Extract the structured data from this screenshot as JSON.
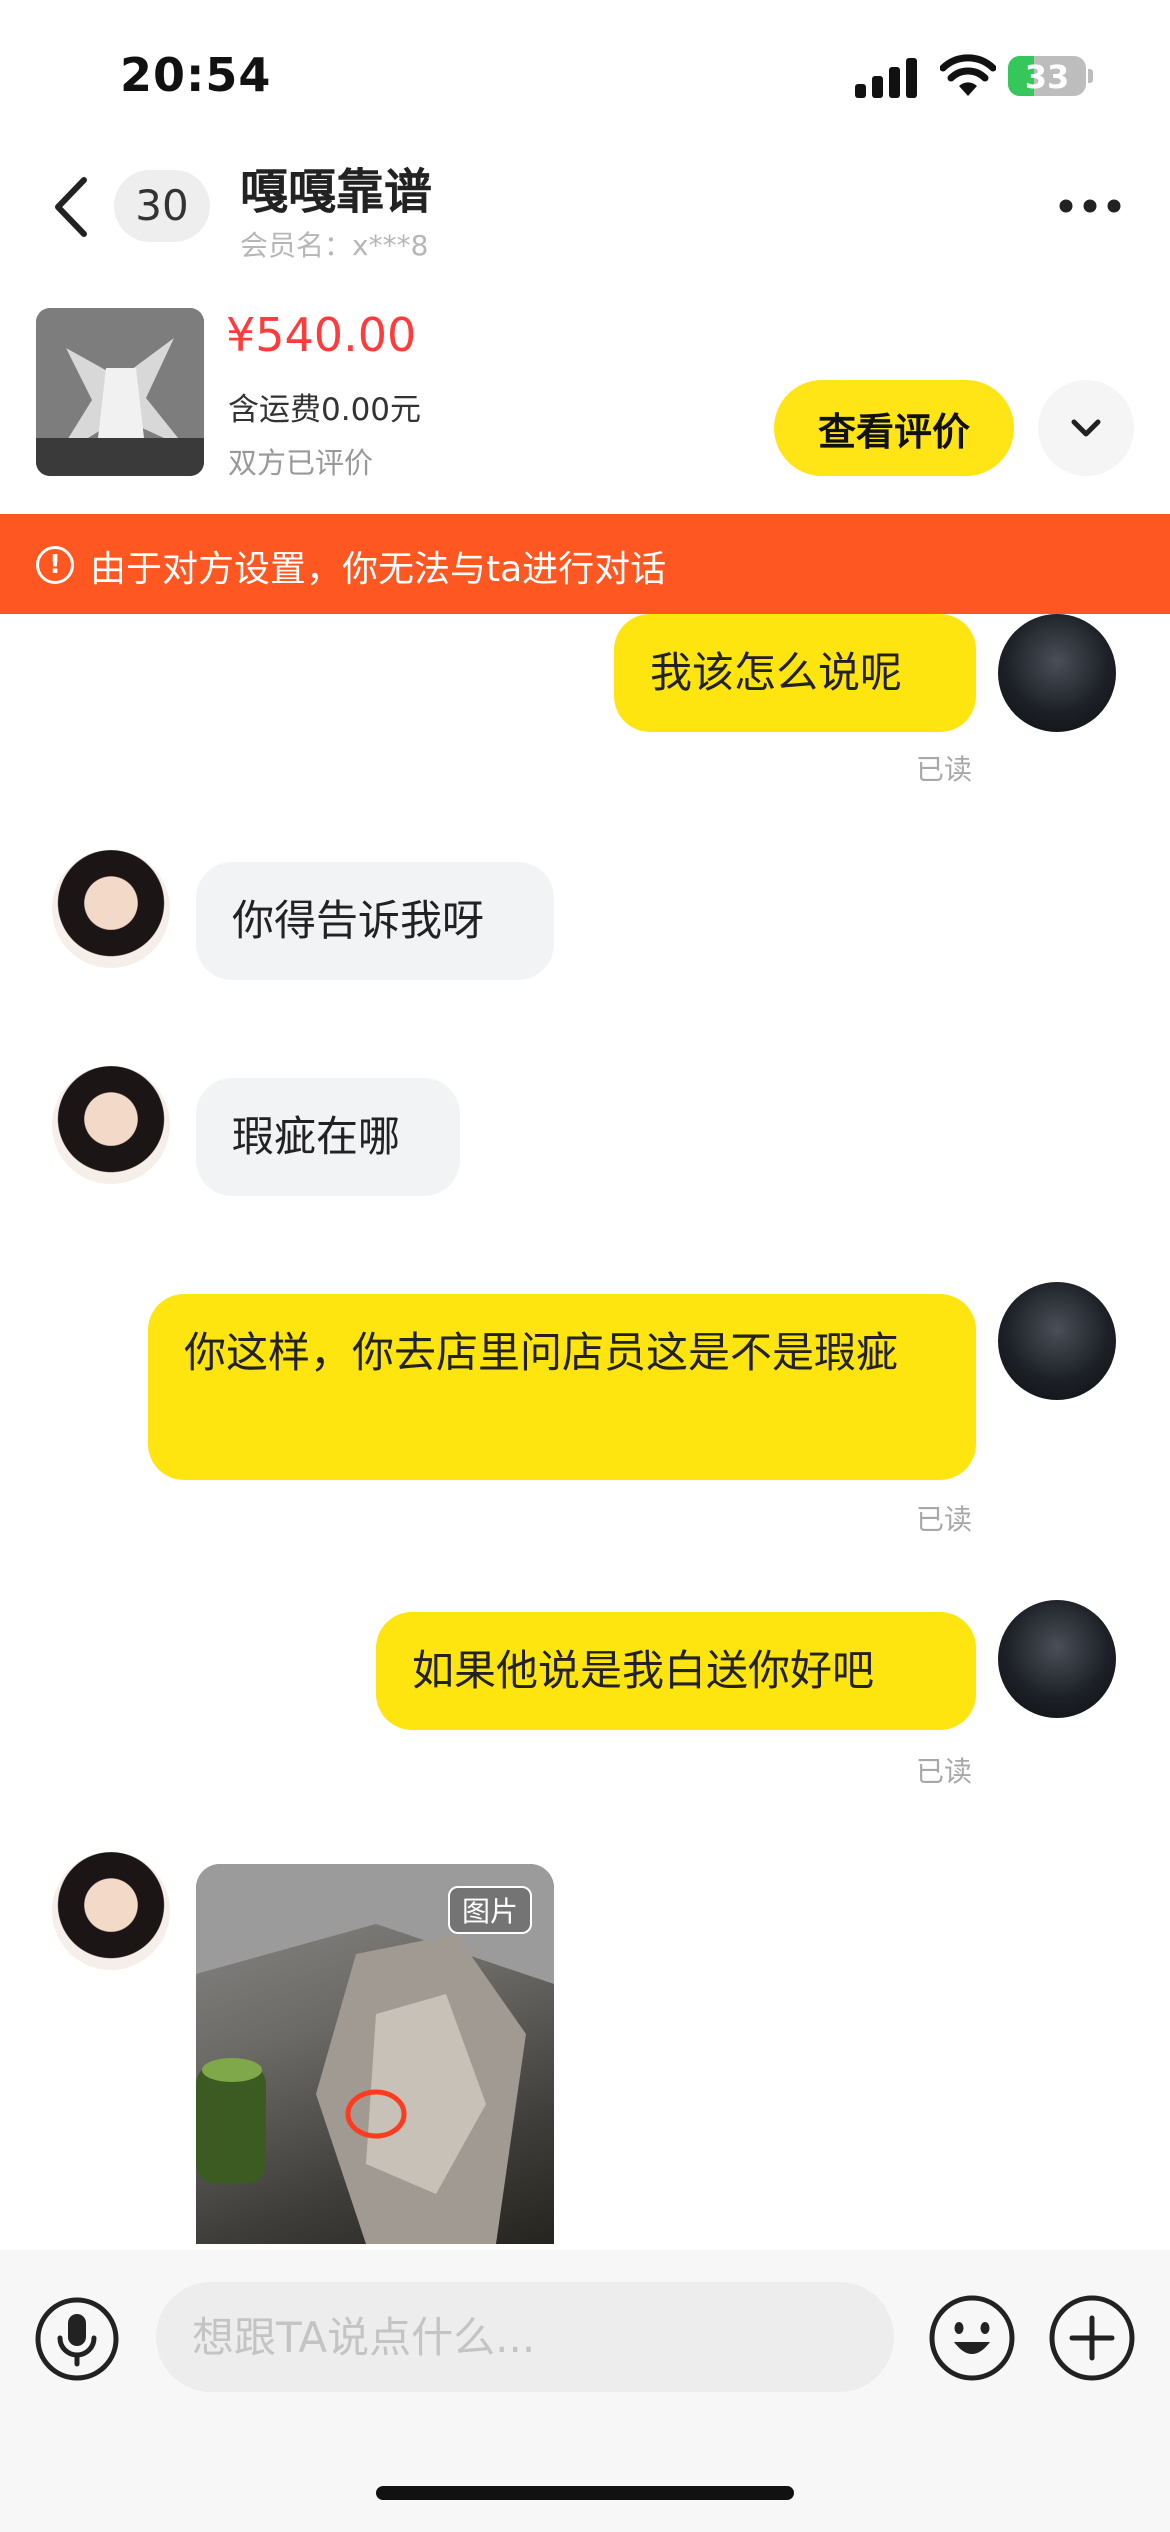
{
  "status_bar": {
    "time": "20:54",
    "battery": "33",
    "battery_level": 0.33
  },
  "header": {
    "unread_count": "30",
    "title": "嘎嘎靠谱",
    "subtitle": "会员名：x***8"
  },
  "product": {
    "price": "¥540.00",
    "shipping": "含运费0.00元",
    "rating_status": "双方已评价",
    "review_button": "查看评价"
  },
  "warning": {
    "text": "由于对方设置，你无法与ta进行对话"
  },
  "messages": [
    {
      "side": "me",
      "text": "我该怎么说呢",
      "status": "已读"
    },
    {
      "side": "them",
      "text": "你得告诉我呀"
    },
    {
      "side": "them",
      "text": "瑕疵在哪"
    },
    {
      "side": "me",
      "text": "你这样，你去店里问店员这是不是瑕疵",
      "status": "已读"
    },
    {
      "side": "me",
      "text": "如果他说是我白送你好吧",
      "status": "已读"
    },
    {
      "side": "them",
      "type": "image",
      "tag": "图片"
    }
  ],
  "input": {
    "placeholder": "想跟TA说点什么..."
  },
  "colors": {
    "accent": "#ffe50f",
    "warning": "#ff5722",
    "price": "#ff3b3b"
  },
  "icons": [
    "back-icon",
    "more-icon",
    "chevron-down-icon",
    "alert-icon",
    "mic-icon",
    "emoji-icon",
    "plus-icon",
    "signal-icon",
    "wifi-icon",
    "battery-icon"
  ]
}
